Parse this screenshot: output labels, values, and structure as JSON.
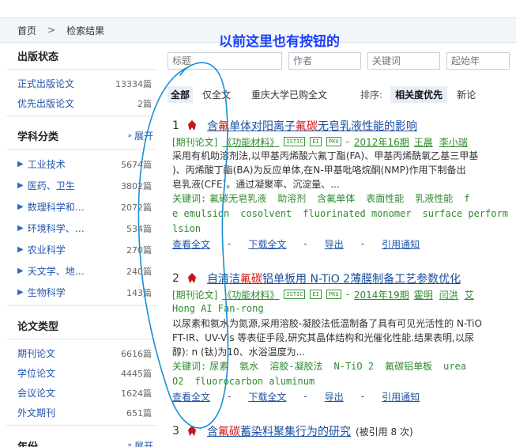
{
  "breadcrumb": {
    "home": "首页",
    "sep": ">",
    "current": "检索结果"
  },
  "sidebar": {
    "publish_status": {
      "title": "出版状态",
      "items": [
        {
          "label": "正式出版论文",
          "count": "13334篇"
        },
        {
          "label": "优先出版论文",
          "count": "2篇"
        }
      ]
    },
    "subjects": {
      "title": "学科分类",
      "expand": "展开",
      "items": [
        {
          "label": "工业技术",
          "count": "5674篇"
        },
        {
          "label": "医药、卫生",
          "count": "3802篇"
        },
        {
          "label": "数理科学和…",
          "count": "2072篇"
        },
        {
          "label": "环境科学、…",
          "count": "534篇"
        },
        {
          "label": "农业科学",
          "count": "270篇"
        },
        {
          "label": "天文学、地…",
          "count": "240篇"
        },
        {
          "label": "生物科学",
          "count": "143篇"
        }
      ]
    },
    "paper_types": {
      "title": "论文类型",
      "items": [
        {
          "label": "期刊论文",
          "count": "6616篇"
        },
        {
          "label": "学位论文",
          "count": "4445篇"
        },
        {
          "label": "会议论文",
          "count": "1624篇"
        },
        {
          "label": "外文期刊",
          "count": "651篇"
        }
      ]
    },
    "year": {
      "title": "年份",
      "expand": "展开"
    }
  },
  "search": {
    "title_placeholder": "标题",
    "author_placeholder": "作者",
    "keyword_placeholder": "关键词",
    "start_year_placeholder": "起始年"
  },
  "tabs": {
    "all": "全部",
    "fulltext": "仅全文",
    "cqu": "重庆大学已购全文",
    "sort_label": "排序:",
    "sort_relevance": "相关度优先",
    "sort_new": "新论"
  },
  "annotation": {
    "text": "以前这里也有按钮的"
  },
  "results": [
    {
      "num": "1",
      "title_parts": [
        "含",
        "氟",
        "单体对阳离子",
        "氟碳",
        "无皂乳液性能的影响"
      ],
      "meta": {
        "type": "[期刊论文]",
        "journal": "《功能材料》",
        "badges": [
          "ISTIC",
          "EI",
          "PKU"
        ],
        "dash": "-",
        "issue": "2012年16期",
        "authors": [
          "王晨",
          "李小瑞"
        ]
      },
      "abstract": [
        "采用有机助溶剂法,以甲基丙烯酸六氟丁酯(FA)、甲基丙烯酰氧乙基三甲基",
        ")、丙烯酸丁酯(BA)为反应单体,在N-甲基吡咯烷酮(NMP)作用下制备出",
        "皂乳液(CFE)。通过凝聚率、沉淀量、..."
      ],
      "keywords_cn": [
        "关键词:",
        "氟碳无皂乳液",
        "助溶剂",
        "含氟单体",
        "表面性能",
        "乳液性能",
        "f"
      ],
      "keywords_en": [
        "e emulsion",
        "cosolvent",
        "fluorinated monomer",
        "surface perform"
      ],
      "keywords_en2": "lsion",
      "actions": {
        "view": "查看全文",
        "download": "下载全文",
        "export": "导出",
        "cite": "引用通知",
        "dash": "-"
      }
    },
    {
      "num": "2",
      "title_parts": [
        "自清洁",
        "氟碳",
        "铝单板用 N-TiO 2薄膜制备工艺参数优化"
      ],
      "meta": {
        "type": "[期刊论文]",
        "journal": "《功能材料》",
        "badges": [
          "ISTIC",
          "EI",
          "PKU"
        ],
        "dash": "-",
        "issue": "2014年19期",
        "authors": [
          "霍明",
          "闫洪",
          "艾"
        ]
      },
      "authors_en": "Hong   AI Fan-rong",
      "abstract": [
        "以尿素和氨水为氮源,采用溶胶-凝胶法低温制备了具有可见光活性的 N-TiO",
        "FT-IR、UV-Vis 等表征手段,研究其晶体结构和光催化性能.结果表明,以尿",
        "醇): n (钛)为10、水浴温度为..."
      ],
      "keywords_cn": [
        "关键词:",
        "尿素",
        "氨水",
        "溶胶-凝胶法",
        "N-TiO 2",
        "氟碳铝单板",
        "urea"
      ],
      "keywords_en": [
        "O2",
        "fluorocarbon aluminum"
      ],
      "actions": {
        "view": "查看全文",
        "download": "下载全文",
        "export": "导出",
        "cite": "引用通知",
        "dash": "-"
      }
    },
    {
      "num": "3",
      "title_parts": [
        "含",
        "氟碳",
        "蓄染料聚集行为的研究"
      ],
      "cite_text": "(被引用 8 次)"
    }
  ]
}
